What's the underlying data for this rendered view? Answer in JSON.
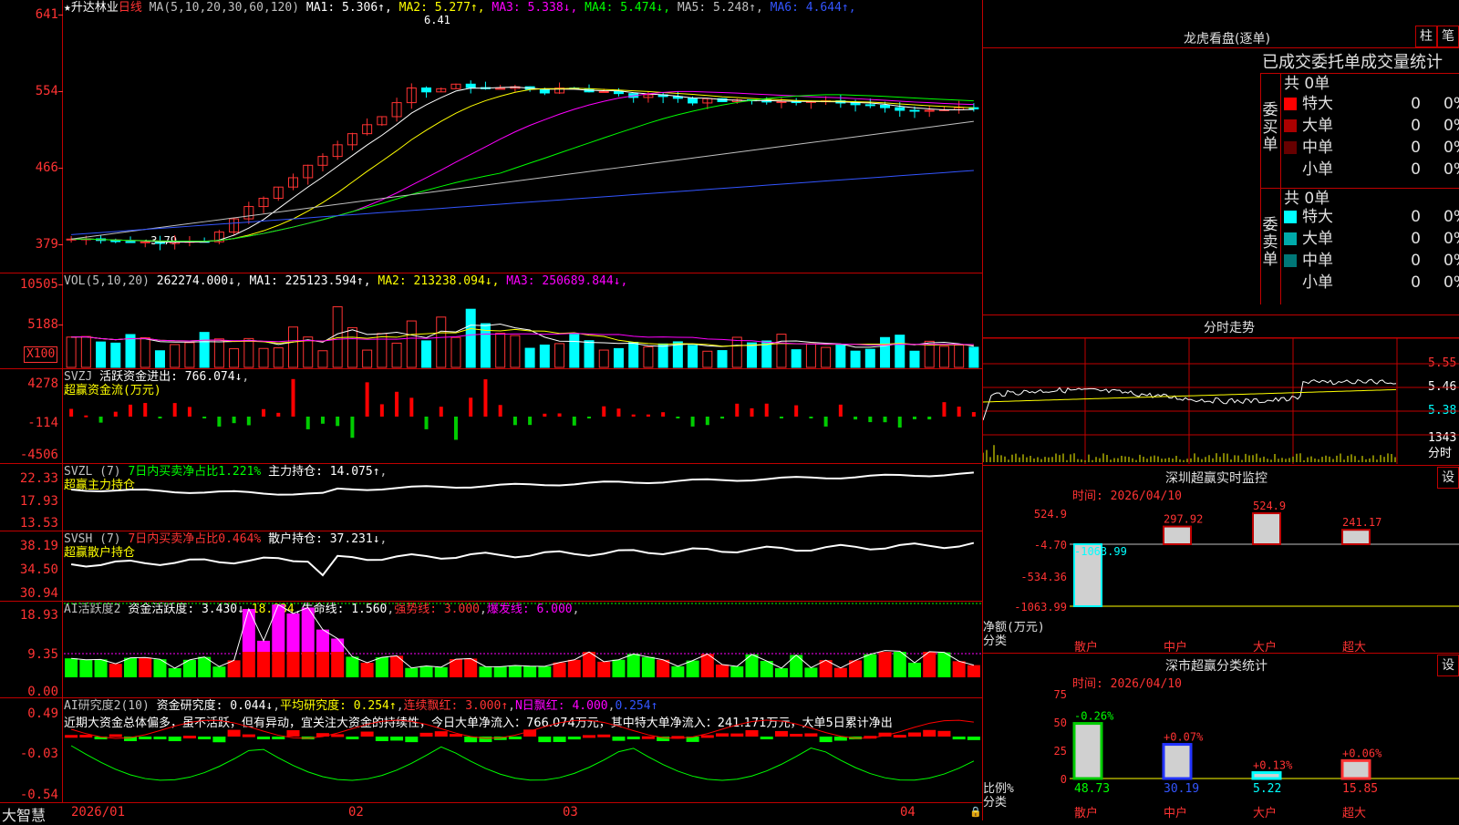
{
  "stock": {
    "title": "★升达林业",
    "period": "日线"
  },
  "main": {
    "ma_title": "MA(5,10,20,30,60,120)",
    "ma_values": [
      {
        "label": "MA1:",
        "value": "5.306↑",
        "color": "#ffffff"
      },
      {
        "label": "MA2:",
        "value": "5.277↑",
        "color": "#ffff00"
      },
      {
        "label": "MA3:",
        "value": "5.338↓",
        "color": "#ff00ff"
      },
      {
        "label": "MA4:",
        "value": "5.474↓",
        "color": "#00ff00"
      },
      {
        "label": "MA5:",
        "value": "5.248↑",
        "color": "#c0c0c0"
      },
      {
        "label": "MA6:",
        "value": "4.644↑",
        "color": "#3355ff"
      }
    ],
    "y_labels": [
      "641",
      "554",
      "466",
      "379"
    ],
    "high_mark": "6.41",
    "low_mark": "←3.79"
  },
  "vol": {
    "title": "VOL(5,10,20)",
    "value": "262274.000↓",
    "ma": [
      {
        "label": "MA1:",
        "value": "225123.594↑",
        "color": "#ffffff"
      },
      {
        "label": "MA2:",
        "value": "213238.094↓",
        "color": "#ffff00"
      },
      {
        "label": "MA3:",
        "value": "250689.844↓",
        "color": "#ff00ff"
      }
    ],
    "y_labels": [
      "10505",
      "5188"
    ],
    "unit": "X100"
  },
  "svzj": {
    "title": "SVZJ",
    "label": "活跃资金进出:",
    "value": "766.074↓",
    "sub": "超赢资金流(万元)",
    "y_labels": [
      "4278",
      "-114",
      "-4506"
    ]
  },
  "svzl": {
    "title": "SVZL (7)",
    "desc": "7日内买卖净占比1.221%",
    "label": "主力持仓:",
    "value": "14.075↑",
    "sub": "超赢主力持仓",
    "y_labels": [
      "22.33",
      "17.93",
      "13.53"
    ]
  },
  "svsh": {
    "title": "SVSH (7)",
    "desc": "7日内买卖净占比0.464%",
    "label": "散户持仓:",
    "value": "37.231↓",
    "sub": "超赢散户持仓",
    "y_labels": [
      "38.19",
      "34.50",
      "30.94"
    ]
  },
  "ai1": {
    "title": "AI活跃度2",
    "label": "资金活跃度:",
    "value": "3.430↓",
    "v2": "18.934",
    "life": "生命线:",
    "life_v": "1.560",
    "strong": "强势线:",
    "strong_v": "3.000",
    "burst": "爆发线:",
    "burst_v": "6.000",
    "y_labels": [
      "18.93",
      "9.35",
      "0.00"
    ]
  },
  "ai2": {
    "title": "AI研究度2(10)",
    "label": "资金研究度:",
    "value": "0.044↓",
    "avg": "平均研究度:",
    "avg_v": "0.254↑",
    "red": "连续飘红:",
    "red_v": "3.000↑",
    "nred": "N日飘红:",
    "nred_v": "4.000",
    "last": "0.254↑",
    "comment": "近期大资金总体偏多，虽不活跃，但有异动，宜关注大资金的持续性，今日大单净流入：766.074万元，其中特大单净流入：241.171万元，大单5日累计净出",
    "y_labels": [
      "0.49",
      "-0.03",
      "-0.54"
    ]
  },
  "xaxis": {
    "labels": [
      "2026/01",
      "02",
      "03",
      "04"
    ],
    "brand": "大智慧"
  },
  "lhb": {
    "title": "龙虎看盘(逐单)",
    "btn1": "柱",
    "btn2": "笔",
    "header": "已成交委托单成交量统计",
    "buy_label": "委买单",
    "sell_label": "委卖单",
    "buy_total": "共 0单",
    "sell_total": "共 0单",
    "buy_rows": [
      {
        "name": "特大",
        "val": "0",
        "pct": "0%",
        "color": "#ff0000"
      },
      {
        "name": "大单",
        "val": "0",
        "pct": "0%",
        "color": "#aa0000"
      },
      {
        "name": "中单",
        "val": "0",
        "pct": "0%",
        "color": "#660000"
      },
      {
        "name": "小单",
        "val": "0",
        "pct": "0%",
        "color": "#000000"
      }
    ],
    "sell_rows": [
      {
        "name": "特大",
        "val": "0",
        "pct": "0%",
        "color": "#00ffff"
      },
      {
        "name": "大单",
        "val": "0",
        "pct": "0%",
        "color": "#00aaaa"
      },
      {
        "name": "中单",
        "val": "0",
        "pct": "0%",
        "color": "#007777"
      },
      {
        "name": "小单",
        "val": "0",
        "pct": "0%",
        "color": "#000000"
      }
    ]
  },
  "fenshi": {
    "title": "分时走势",
    "y_labels": [
      "5.55",
      "5.46",
      "5.38"
    ],
    "vol_label": "1343",
    "vol_unit": "分时"
  },
  "sz_monitor": {
    "title": "深圳超赢实时监控",
    "btn": "设",
    "time": "时间: 2026/04/10",
    "y_labels": [
      "524.9",
      "-4.70",
      "-534.36",
      "-1063.99"
    ],
    "ylabel": "净额(万元)",
    "xlabel": "分类",
    "cats": [
      "散户",
      "中户",
      "大户",
      "超大"
    ],
    "values": [
      -1063.99,
      297.92,
      524.9,
      241.17
    ],
    "value_labels": [
      "-1063.99",
      "297.92",
      "524.9",
      "241.17"
    ]
  },
  "sz_class": {
    "title": "深市超赢分类统计",
    "btn": "设",
    "time": "时间: 2026/04/10",
    "y_labels": [
      "75",
      "50",
      "25",
      "0"
    ],
    "ylabel": "比例%",
    "xlabel": "分类",
    "cats": [
      "散户",
      "中户",
      "大户",
      "超大"
    ],
    "values": [
      48.73,
      30.19,
      5.22,
      15.85
    ],
    "changes": [
      "-0.26%",
      "+0.07%",
      "+0.13%",
      "+0.06%"
    ]
  }
}
